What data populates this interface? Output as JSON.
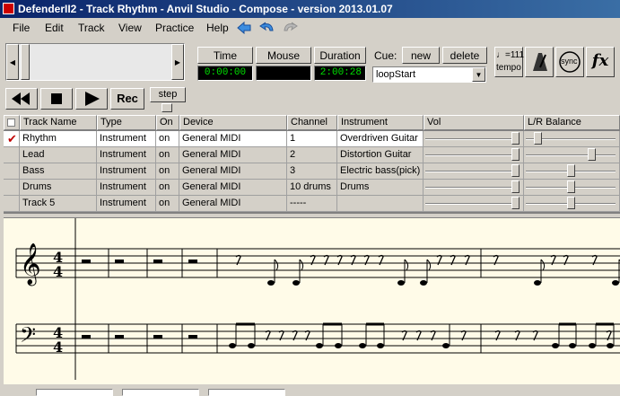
{
  "window": {
    "title": "DefenderII2 - Track Rhythm - Anvil Studio - Compose - version 2013.01.07"
  },
  "menu": [
    "File",
    "Edit",
    "Track",
    "View",
    "Practice",
    "Help"
  ],
  "transport": {
    "time_label": "Time",
    "mouse_label": "Mouse",
    "duration_label": "Duration",
    "time_value": "0:00:00",
    "mouse_value": "",
    "duration_value": "2:00:28",
    "cue_label": "Cue:",
    "cue_new": "new",
    "cue_delete": "delete",
    "cue_selected": "loopStart",
    "tempo_value": "♩=111",
    "tempo_label": "tempo",
    "sync_label": "sync",
    "fx_label": "fx",
    "rec_label": "Rec",
    "step_label": "step"
  },
  "tracks": {
    "headers": [
      "Track Name",
      "Type",
      "On",
      "Device",
      "Channel",
      "Instrument",
      "Vol",
      "L/R Balance"
    ],
    "rows": [
      {
        "checked": true,
        "name": "Rhythm",
        "type": "Instrument",
        "on": "on",
        "device": "General MIDI",
        "channel": "1",
        "instrument": "Overdriven Guitar",
        "vol": 1.0,
        "balance": 0.1,
        "selected": true
      },
      {
        "checked": false,
        "name": "Lead",
        "type": "Instrument",
        "on": "on",
        "device": "General MIDI",
        "channel": "2",
        "instrument": "Distortion Guitar",
        "vol": 1.0,
        "balance": 0.75,
        "selected": false
      },
      {
        "checked": false,
        "name": "Bass",
        "type": "Instrument",
        "on": "on",
        "device": "General MIDI",
        "channel": "3",
        "instrument": "Electric bass(pick)",
        "vol": 1.0,
        "balance": 0.5,
        "selected": false
      },
      {
        "checked": false,
        "name": "Drums",
        "type": "Instrument",
        "on": "on",
        "device": "General MIDI",
        "channel": "10 drums",
        "instrument": "Drums",
        "vol": 1.0,
        "balance": 0.5,
        "selected": false
      },
      {
        "checked": false,
        "name": "Track 5",
        "type": "Instrument",
        "on": "on",
        "device": "General MIDI",
        "channel": "-----",
        "instrument": "",
        "vol": 1.0,
        "balance": 0.5,
        "selected": false
      }
    ]
  },
  "score": {
    "treble_time": [
      "4",
      "4"
    ],
    "bass_time": [
      "4",
      "4"
    ]
  },
  "colors": {
    "title_start": "#0a246a",
    "title_end": "#3a6ea5",
    "lcd_text": "#00e000",
    "score_bg": "#fffbe8",
    "check": "#c00000"
  }
}
